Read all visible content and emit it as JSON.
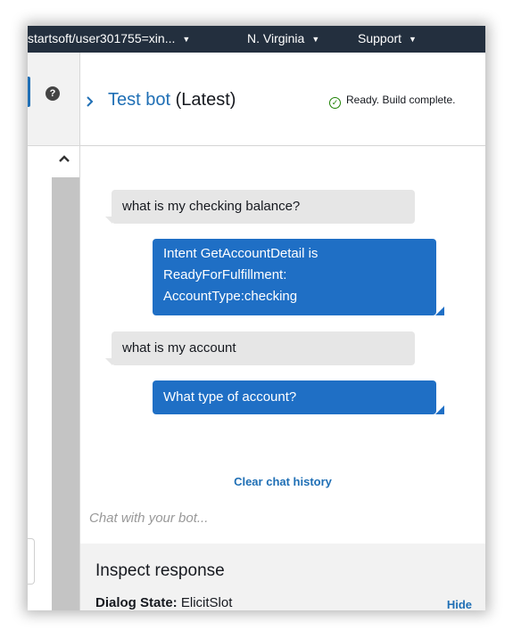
{
  "topnav": {
    "account": "startsoft/user301755=xin...",
    "region": "N. Virginia",
    "support": "Support"
  },
  "panel": {
    "title_link": "Test bot",
    "title_suffix": " (Latest)",
    "status": "Ready. Build complete."
  },
  "chat": {
    "messages": [
      {
        "from": "user",
        "text": "what is my checking balance?"
      },
      {
        "from": "bot",
        "lines": [
          "Intent GetAccountDetail is",
          "ReadyForFulfillment:",
          "AccountType:checking"
        ]
      },
      {
        "from": "user",
        "text": "what is my account"
      },
      {
        "from": "bot",
        "lines": [
          "What type of account?"
        ]
      }
    ],
    "clear_label": "Clear chat history",
    "input_placeholder": "Chat with your bot..."
  },
  "inspect": {
    "title": "Inspect response",
    "dialog_state_label": "Dialog State:",
    "dialog_state_value": " ElicitSlot",
    "hide_label": "Hide"
  },
  "icons": {
    "help": "help-circle-icon",
    "scroll_up": "chevron-up-icon",
    "expand": "chevron-right-icon",
    "status": "check-circle-icon"
  },
  "colors": {
    "nav_bg": "#232f3e",
    "link_blue": "#1f6fb5",
    "bot_bubble": "#1f6fc5",
    "user_bubble": "#e6e6e6",
    "success_green": "#1d8102"
  }
}
